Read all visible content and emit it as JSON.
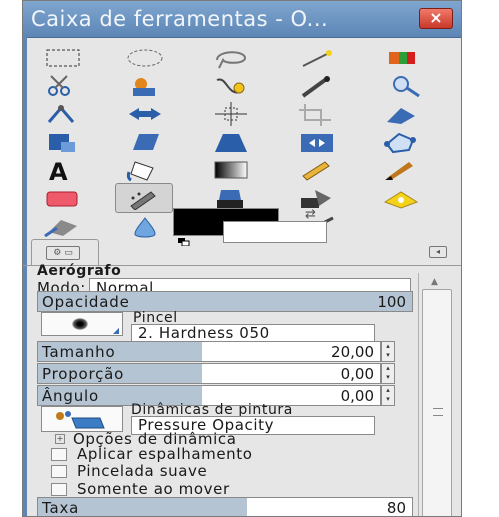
{
  "window": {
    "title": "Caixa de ferramentas - O...",
    "close_label": "×"
  },
  "tools": [
    {
      "name": "rect-select-icon"
    },
    {
      "name": "ellipse-select-icon"
    },
    {
      "name": "lasso-icon"
    },
    {
      "name": "fuzzy-select-icon"
    },
    {
      "name": "color-select-icon"
    },
    {
      "name": "scissors-icon"
    },
    {
      "name": "foreground-select-icon"
    },
    {
      "name": "paths-icon"
    },
    {
      "name": "color-picker-icon"
    },
    {
      "name": "zoom-icon"
    },
    {
      "name": "measure-icon"
    },
    {
      "name": "move-icon"
    },
    {
      "name": "align-icon"
    },
    {
      "name": "crop-icon"
    },
    {
      "name": "rotate-icon"
    },
    {
      "name": "scale-icon"
    },
    {
      "name": "shear-icon"
    },
    {
      "name": "perspective-icon"
    },
    {
      "name": "flip-icon"
    },
    {
      "name": "cage-icon"
    },
    {
      "name": "text-icon"
    },
    {
      "name": "bucket-fill-icon"
    },
    {
      "name": "blend-icon"
    },
    {
      "name": "pencil-icon"
    },
    {
      "name": "paintbrush-icon"
    },
    {
      "name": "eraser-icon"
    },
    {
      "name": "airbrush-icon",
      "selected": true
    },
    {
      "name": "ink-icon"
    },
    {
      "name": "clone-icon"
    },
    {
      "name": "heal-icon"
    },
    {
      "name": "perspective-clone-icon"
    },
    {
      "name": "blur-icon"
    },
    {
      "name": "smudge-icon"
    },
    {
      "name": "dodge-burn-icon"
    }
  ],
  "colors": {
    "foreground": "#000000",
    "background": "#ffffff",
    "slider_fill": "#b5c4d3",
    "titlebar": "#6f97c4"
  },
  "options": {
    "tool_title": "Aerógrafo",
    "mode_label": "Modo:",
    "mode_value": "Normal",
    "opacity": {
      "label": "Opacidade",
      "value": "100"
    },
    "brush_label": "Pincel",
    "brush_value": "2. Hardness 050",
    "size": {
      "label": "Tamanho",
      "value": "20,00"
    },
    "aspect": {
      "label": "Proporção",
      "value": "0,00"
    },
    "angle": {
      "label": "Ângulo",
      "value": "0,00"
    },
    "dynamics_label": "Dinâmicas de pintura",
    "dynamics_value": "Pressure Opacity",
    "dynamics_options": "Opções de dinâmica",
    "apply_jitter": "Aplicar espalhamento",
    "smooth_stroke": "Pincelada suave",
    "motion_only": "Somente ao mover",
    "rate": {
      "label": "Taxa",
      "value": "80"
    }
  }
}
